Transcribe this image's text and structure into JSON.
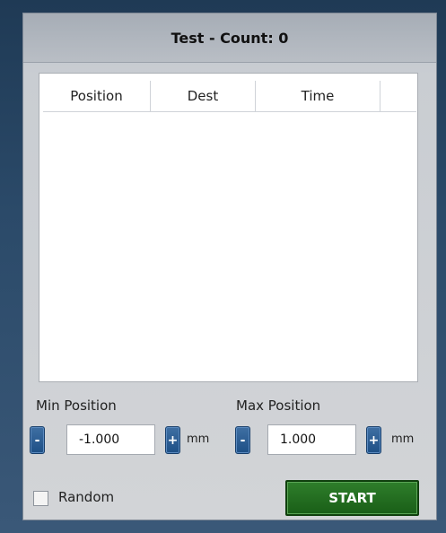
{
  "window": {
    "title": "Test - Count: 0"
  },
  "table": {
    "columns": [
      "Position",
      "Dest",
      "Time",
      ""
    ],
    "rows": []
  },
  "min_position": {
    "label": "Min Position",
    "minus": "-",
    "value": "-1.000",
    "plus": "+",
    "unit": "mm"
  },
  "max_position": {
    "label": "Max Position",
    "minus": "-",
    "value": "1.000",
    "plus": "+",
    "unit": "mm"
  },
  "random": {
    "label": "Random",
    "checked": false
  },
  "start_button": {
    "label": "START"
  },
  "colors": {
    "start_green": "#1f6a1c",
    "stepper_blue": "#1d4f86"
  }
}
